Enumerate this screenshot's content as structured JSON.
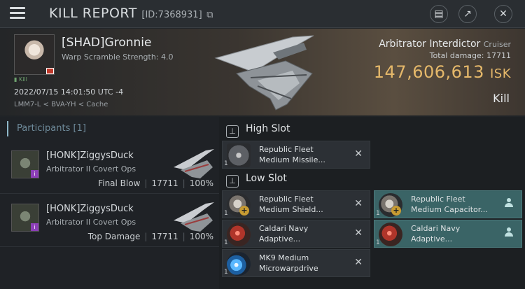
{
  "titlebar": {
    "title": "KILL REPORT",
    "report_id": "[ID:7368931]",
    "icons": [
      "menu-icon",
      "copy-icon",
      "clipboard-icon",
      "share-icon",
      "close-icon"
    ]
  },
  "victim": {
    "name": "[SHAD]Gronnie",
    "warp_scramble": "Warp Scramble Strength: 4.0",
    "corp_tag": "Kill",
    "datetime": "2022/07/15 14:01:50 UTC -4",
    "location": "LMM7-L < BVA-YH < Cache",
    "ship_name": "Arbitrator Interdictor",
    "ship_class": "Cruiser",
    "total_damage_label": "Total damage:",
    "total_damage": "17711",
    "isk_value": "147,606,613",
    "isk_unit": "ISK",
    "result": "Kill"
  },
  "participants": {
    "header": "Participants [1]",
    "rows": [
      {
        "name": "[HONK]ZiggysDuck",
        "ship": "Arbitrator II Covert Ops",
        "tag": "Final Blow",
        "damage": "17711",
        "percent": "100%"
      },
      {
        "name": "[HONK]ZiggysDuck",
        "ship": "Arbitrator II Covert Ops",
        "tag": "Top Damage",
        "damage": "17711",
        "percent": "100%"
      }
    ]
  },
  "slots": {
    "high": {
      "label": "High Slot",
      "modules": [
        {
          "line1": "Republic Fleet",
          "line2": "Medium Missile...",
          "qty": "1"
        }
      ]
    },
    "low": {
      "label": "Low Slot",
      "modules": [
        {
          "line1": "Republic Fleet",
          "line2": "Medium Shield...",
          "qty": "1"
        },
        {
          "line1": "Caldari Navy",
          "line2": "Adaptive...",
          "qty": "1"
        },
        {
          "line1": "MK9 Medium",
          "line2": "Microwarpdrive",
          "qty": "1"
        }
      ],
      "fitted": [
        {
          "line1": "Republic Fleet",
          "line2": "Medium Capacitor...",
          "qty": "1"
        },
        {
          "line1": "Caldari Navy",
          "line2": "Adaptive...",
          "qty": "1"
        }
      ]
    }
  },
  "colors": {
    "accent_isk": "#e5b86a",
    "fitted_bg": "#3a6466",
    "badge_red": "#c0392b",
    "badge_purple": "#8d3fb8"
  }
}
